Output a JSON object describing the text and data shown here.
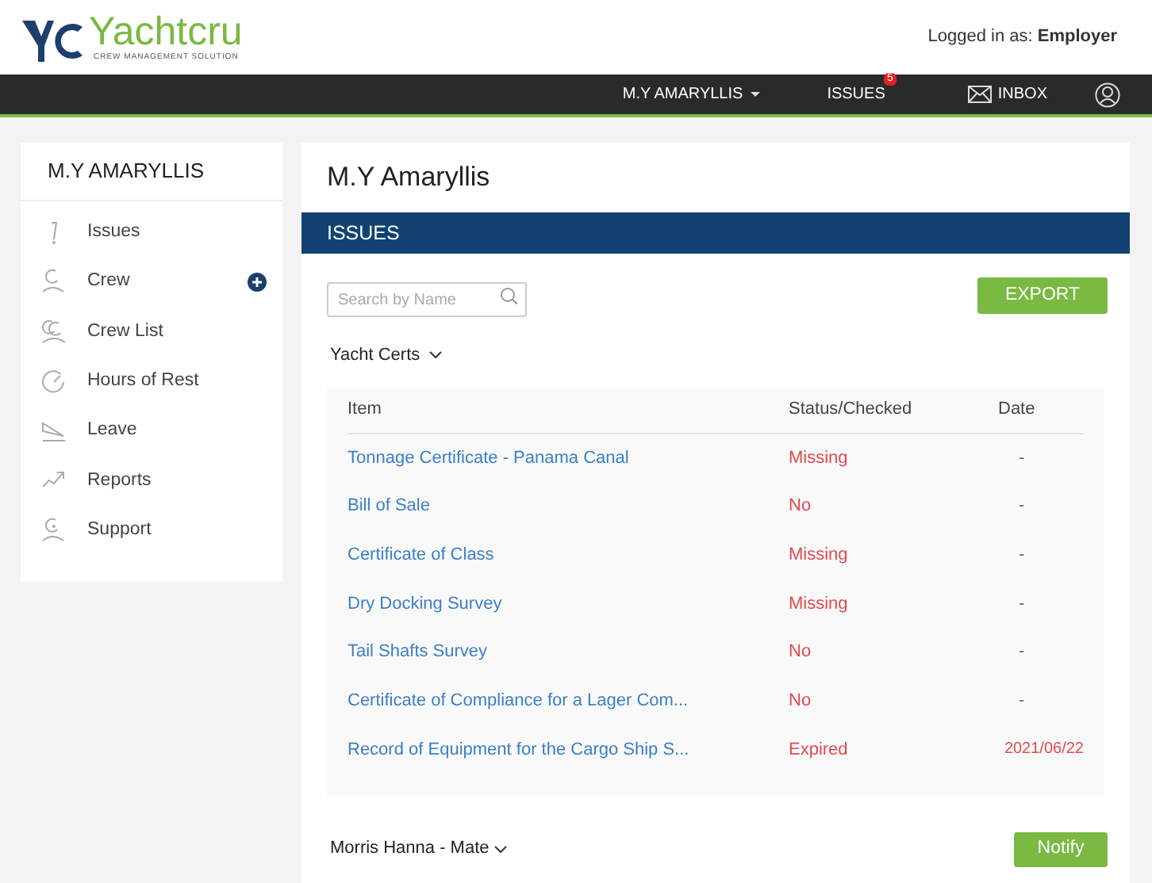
{
  "header": {
    "logo_text": "Yachtcru",
    "logo_tagline": "CREW MANAGEMENT SOLUTION",
    "login_label": "Logged in as:",
    "login_role": "Employer"
  },
  "nav": {
    "vessel": "M.Y AMARYLLIS",
    "issues": "ISSUES",
    "issues_badge": "5",
    "inbox": "INBOX"
  },
  "sidebar": {
    "title": "M.Y AMARYLLIS",
    "items": [
      {
        "label": "Issues",
        "add_button": false
      },
      {
        "label": "Crew",
        "add_button": true
      },
      {
        "label": "Crew List",
        "add_button": false
      },
      {
        "label": "Hours of Rest",
        "add_button": false
      },
      {
        "label": "Leave",
        "add_button": false
      },
      {
        "label": "Reports",
        "add_button": false
      },
      {
        "label": "Support",
        "add_button": false
      }
    ]
  },
  "main": {
    "title": "M.Y Amaryllis",
    "section": "ISSUES",
    "search": {
      "placeholder": "Search by Name"
    },
    "export_button": "EXPORT",
    "group": "Yacht Certs",
    "table": {
      "columns": [
        "Item",
        "Status/Checked",
        "Date"
      ],
      "rows": [
        {
          "item": "Tonnage Certificate - Panama Canal",
          "status": "Missing",
          "date": "-",
          "overdue": false
        },
        {
          "item": "Bill of Sale",
          "status": "No",
          "date": "-",
          "overdue": false
        },
        {
          "item": "Certificate of Class",
          "status": "Missing",
          "date": "-",
          "overdue": false
        },
        {
          "item": "Dry Docking Survey",
          "status": "Missing",
          "date": "-",
          "overdue": false
        },
        {
          "item": "Tail Shafts Survey",
          "status": "No",
          "date": "-",
          "overdue": false
        },
        {
          "item": "Certificate of Compliance for a Lager Com...",
          "status": "No",
          "date": "-",
          "overdue": false
        },
        {
          "item": "Record of Equipment for the Cargo Ship S...",
          "status": "Expired",
          "date": "2021/06/22",
          "overdue": true
        }
      ]
    },
    "crew_group": "Morris Hanna - Mate",
    "notify_button": "Notify"
  }
}
